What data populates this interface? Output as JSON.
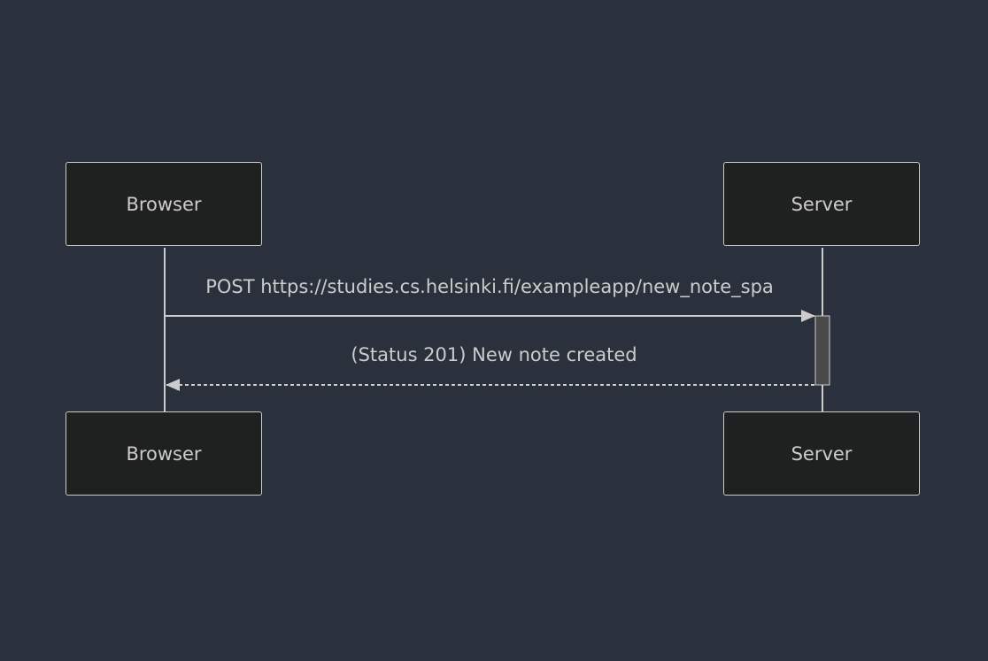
{
  "participants": [
    {
      "id": "browser",
      "label": "Browser"
    },
    {
      "id": "server",
      "label": "Server"
    }
  ],
  "messages": [
    {
      "from": "browser",
      "to": "server",
      "label": "POST https://studies.cs.helsinki.fi/exampleapp/new_note_spa",
      "style": "solid"
    },
    {
      "from": "server",
      "to": "browser",
      "label": "(Status 201) New note created",
      "style": "dashed"
    }
  ],
  "colors": {
    "background": "#2a303c",
    "actor_fill": "#1f2020",
    "line": "#cccccc",
    "activation": "#4a4a4a"
  }
}
